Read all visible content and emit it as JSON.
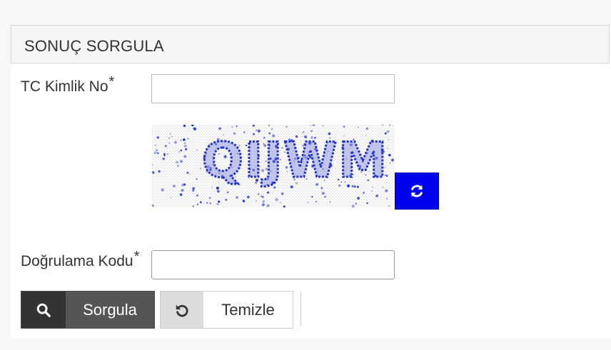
{
  "panel": {
    "title": "SONUÇ SORGULA"
  },
  "form": {
    "tc_label": "TC Kimlik No",
    "tc_value": "",
    "captcha_text": "QIJWM",
    "verification_label": "Doğrulama Kodu",
    "verification_value": "",
    "required_mark": "*"
  },
  "buttons": {
    "query_label": "Sorgula",
    "clear_label": "Temizle"
  },
  "icons": {
    "refresh": "refresh-icon",
    "search": "search-icon",
    "undo": "undo-icon"
  },
  "colors": {
    "refresh_bg": "#0000ee",
    "query_bg": "#555555",
    "captcha_text": "#2233cc"
  }
}
